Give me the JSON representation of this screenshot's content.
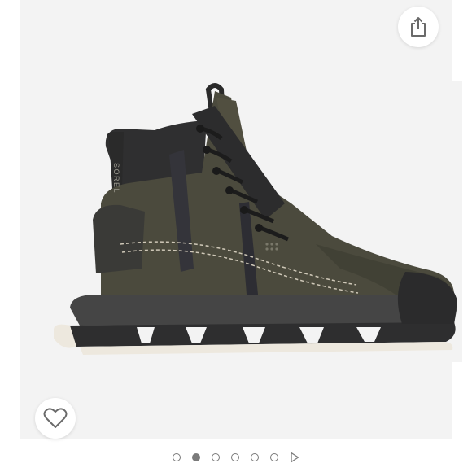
{
  "product_image": {
    "brand_text": "SOREL",
    "colors": {
      "background": "#f3f3f3",
      "upper": "#4b4a3d",
      "upper_shadow": "#3b3a30",
      "sole": "#2e2e2f",
      "midsole": "#454545",
      "outsole_trim": "#ede8de",
      "laces": "#1c1c1c",
      "stitching": "#cfc8b8"
    }
  },
  "actions": {
    "share_icon": "share-icon",
    "like_icon": "heart-outline-icon"
  },
  "carousel": {
    "total_slides": 6,
    "active_slide": 2,
    "next_icon": "play-triangle-icon"
  }
}
